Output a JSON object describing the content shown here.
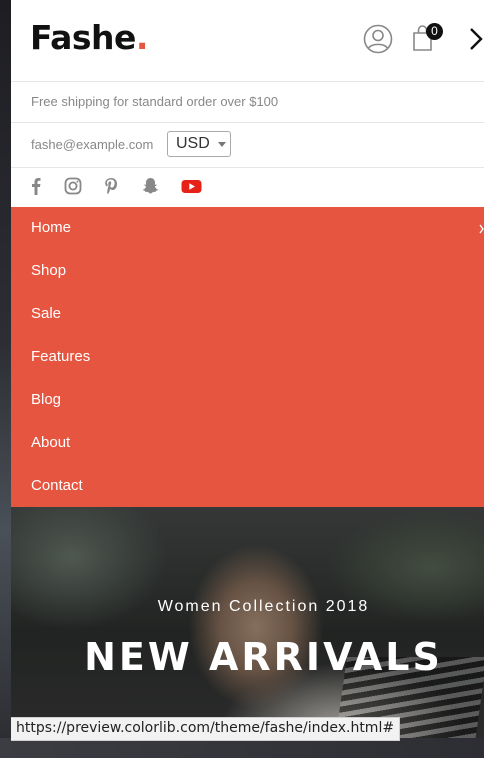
{
  "header": {
    "logo_text": "Fashe",
    "logo_dot": ".",
    "cart_count": "0",
    "accent_color": "#e65540"
  },
  "topbar": {
    "shipping_text": "Free shipping for standard order over $100",
    "email": "fashe@example.com",
    "currency": "USD"
  },
  "social_icons": [
    "facebook-icon",
    "instagram-icon",
    "pinterest-icon",
    "snapchat-icon",
    "youtube-icon"
  ],
  "menu": {
    "background_color": "#e65540",
    "items": [
      {
        "label": "Home"
      },
      {
        "label": "Shop"
      },
      {
        "label": "Sale"
      },
      {
        "label": "Features"
      },
      {
        "label": "Blog"
      },
      {
        "label": "About"
      },
      {
        "label": "Contact"
      }
    ]
  },
  "hero": {
    "subtitle": "Women Collection 2018",
    "title": "NEW ARRIVALS"
  },
  "status_bar": {
    "url": "https://preview.colorlib.com/theme/fashe/index.html#"
  }
}
